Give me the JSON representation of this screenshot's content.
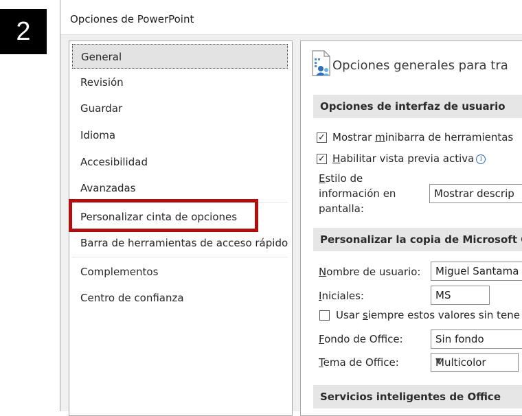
{
  "step_badge": "2",
  "window": {
    "title": "Opciones de PowerPoint"
  },
  "sidebar": {
    "items": [
      {
        "label": "General"
      },
      {
        "label": "Revisión"
      },
      {
        "label": "Guardar"
      },
      {
        "label": "Idioma"
      },
      {
        "label": "Accesibilidad"
      },
      {
        "label": "Avanzadas"
      },
      {
        "label": "Personalizar cinta de opciones"
      },
      {
        "label": "Barra de herramientas de acceso rápido"
      },
      {
        "label": "Complementos"
      },
      {
        "label": "Centro de confianza"
      }
    ],
    "selected": "General",
    "highlighted": "Personalizar cinta de opciones"
  },
  "main": {
    "title": "Opciones generales para tra",
    "ui_section": {
      "heading": "Opciones de interfaz de usuario",
      "minibar": {
        "label_pre": "Mostrar ",
        "label_u": "m",
        "label_post": "inibarra de herramientas",
        "checked": "✓"
      },
      "live_preview": {
        "label_u": "H",
        "label_post": "abilitar vista previa activa",
        "checked": "✓"
      },
      "tooltip_style": {
        "label_u": "E",
        "label_line1": "stilo de",
        "label_line2": "información en",
        "label_line3": "pantalla:",
        "value": "Mostrar descrip"
      }
    },
    "copy_section": {
      "heading": "Personalizar la copia de Microsoft Off",
      "username": {
        "label_u": "N",
        "label_post": "ombre de usuario:",
        "value": "Miguel Santama"
      },
      "initials": {
        "label_u": "I",
        "label_post": "niciales:",
        "value": "MS"
      },
      "always_use": {
        "label_pre": "Usar ",
        "label_u": "s",
        "label_post": "iempre estos valores sin tene",
        "checked": ""
      },
      "background": {
        "label_u": "F",
        "label_post": "ondo de Office:",
        "value": "Sin fondo"
      },
      "theme": {
        "label_u": "T",
        "label_post": "ema de Office:",
        "value": "Multicolor"
      }
    },
    "services_section": {
      "heading": "Servicios inteligentes de Office"
    }
  }
}
